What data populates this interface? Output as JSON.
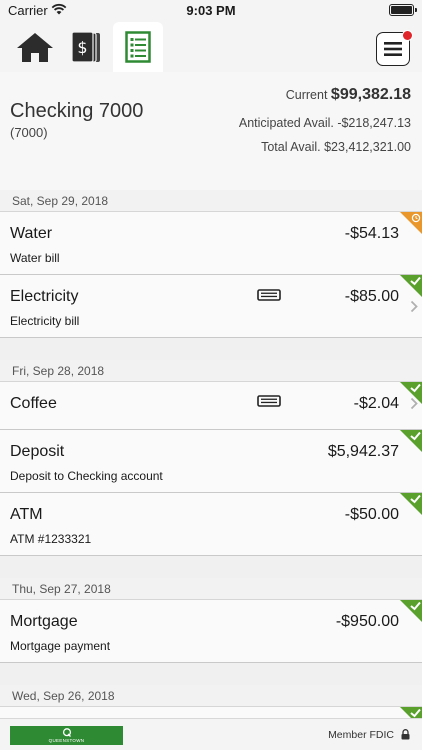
{
  "status_bar": {
    "carrier": "Carrier",
    "time": "9:03 PM"
  },
  "nav": {
    "tabs": [
      {
        "icon": "home-icon"
      },
      {
        "icon": "dollar-cards-icon"
      },
      {
        "icon": "ledger-icon",
        "active": true
      }
    ],
    "menu_icon": "hamburger-menu-icon",
    "notification_color": "#e0252b"
  },
  "account": {
    "name": "Checking 7000",
    "number": "(7000)",
    "current_label": "Current",
    "current_value": "$99,382.18",
    "anticipated": "Anticipated Avail. -$218,247.13",
    "total": "Total Avail. $23,412,321.00"
  },
  "transactions": {
    "groups": [
      {
        "date": "Sat, Sep 29, 2018",
        "items": [
          {
            "name": "Water",
            "desc": "Water bill",
            "amount": "-$54.13",
            "status": "pending"
          },
          {
            "name": "Electricity",
            "desc": "Electricity bill",
            "amount": "-$85.00",
            "status": "cleared"
          }
        ]
      },
      {
        "date": "Fri, Sep 28, 2018",
        "items": [
          {
            "name": "Coffee",
            "amount": "-$2.04",
            "status": "cleared"
          },
          {
            "name": "Deposit",
            "desc": "Deposit to Checking account",
            "amount": "$5,942.37",
            "status": "cleared"
          },
          {
            "name": "ATM",
            "desc": "ATM #1233321",
            "amount": "-$50.00",
            "status": "cleared"
          }
        ]
      },
      {
        "date": "Thu, Sep 27, 2018",
        "items": [
          {
            "name": "Mortgage",
            "desc": "Mortgage payment",
            "amount": "-$950.00",
            "status": "cleared"
          }
        ]
      },
      {
        "date": "Wed, Sep 26, 2018",
        "items": []
      }
    ]
  },
  "colors": {
    "cleared": "#5aa02c",
    "pending": "#e9962a",
    "brand_green": "#2f8a34"
  },
  "footer": {
    "fdic": "Member FDIC"
  }
}
